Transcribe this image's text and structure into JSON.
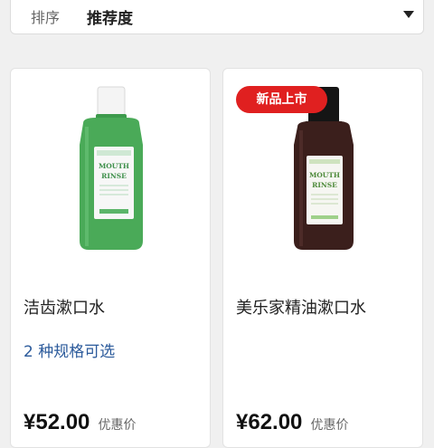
{
  "sort": {
    "label": "排序",
    "value": "推荐度",
    "caret_icon": "caret-down-icon"
  },
  "products": [
    {
      "name": "洁齿漱口水",
      "variants": "2 种规格可选",
      "price": "¥52.00",
      "price_label": "优惠价",
      "image": {
        "top_text": "MOUTH",
        "bottom_text": "RINSE",
        "bottle_color": "#4aaa58",
        "cap_color": "#f4f4f4"
      }
    },
    {
      "name": "美乐家精油漱口水",
      "badge": "新品上市",
      "variants": "",
      "price": "¥62.00",
      "price_label": "优惠价",
      "image": {
        "top_text": "MOUTH",
        "bottom_text": "RINSE",
        "bottle_color": "#3b1f1c",
        "cap_color": "#151515"
      }
    }
  ],
  "colors": {
    "badge_bg": "#e02020",
    "variants_text": "#2b5a9b",
    "page_bg": "#f0f0f0"
  }
}
